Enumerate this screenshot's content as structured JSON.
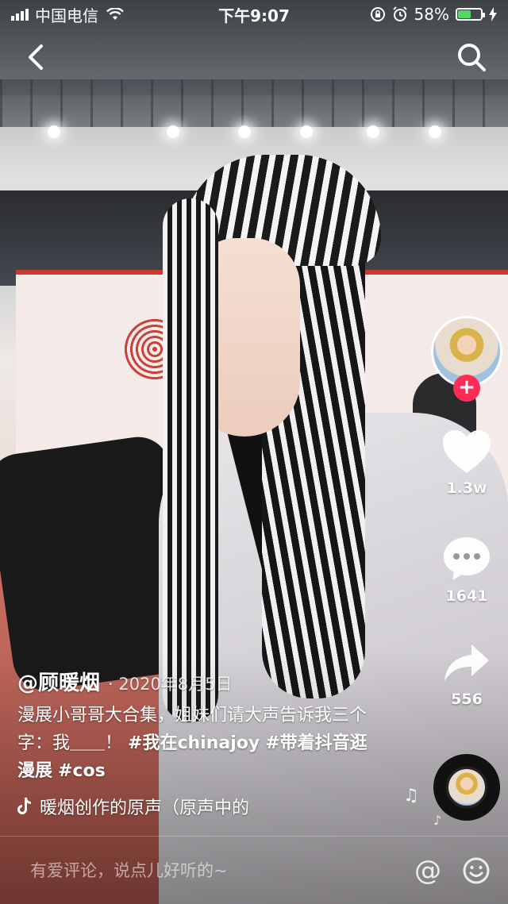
{
  "status_bar": {
    "carrier": "中国电信",
    "time": "下午9:07",
    "battery_percent": "58%",
    "battery_level": 0.58
  },
  "icons": {
    "back": "chevron-left-icon",
    "search": "search-icon",
    "like": "heart-icon",
    "comment": "comment-bubble-icon",
    "share": "share-arrow-icon",
    "music": "tiktok-note-icon",
    "at": "at-icon",
    "emoji": "smiley-icon"
  },
  "video": {
    "author": "@顾暖烟",
    "date": "· 2020年8月5日",
    "caption_plain_1": "漫展小哥哥大合集，姐妹们请大声告诉我三个字：我＿＿！",
    "hashtag_1": "#我在chinajoy",
    "hashtag_2": "#带着抖音逛漫展",
    "hashtag_3": "#cos",
    "music_text": "暖烟创作的原声（原声中的"
  },
  "actions": {
    "follow_symbol": "+",
    "likes": "1.3w",
    "comments": "1641",
    "shares": "556"
  },
  "comment_bar": {
    "placeholder": "有爱评论，说点儿好听的~",
    "at_symbol": "@"
  },
  "colors": {
    "follow": "#fe2c55",
    "battery": "#4cd964"
  }
}
